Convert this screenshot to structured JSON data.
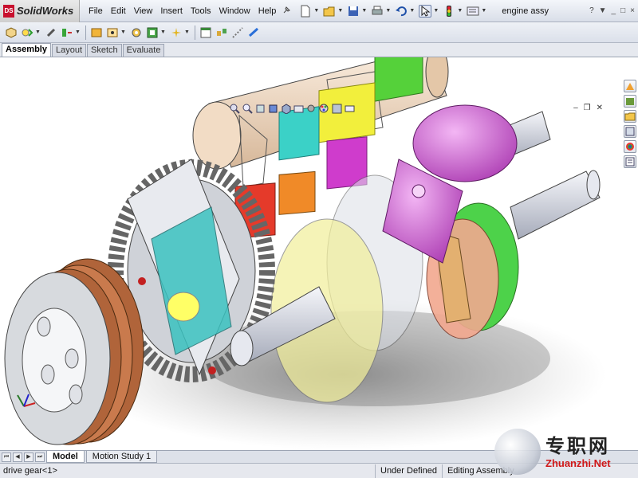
{
  "app": {
    "brand": "SolidWorks",
    "menus": [
      "File",
      "Edit",
      "View",
      "Insert",
      "Tools",
      "Window",
      "Help"
    ],
    "document_title": "engine assy",
    "window_controls": [
      "?",
      "_",
      "□",
      "×"
    ]
  },
  "toolbar_icons": [
    "new-icon",
    "open-icon",
    "save-icon",
    "print-icon",
    "undo-icon",
    "select-icon",
    "rebuild-icon",
    "options-icon"
  ],
  "command_icons": [
    "insert-component-icon",
    "mate-icon",
    "smart-fasteners-icon",
    "linear-pattern-icon",
    "move-component-icon",
    "show-hidden-icon",
    "assembly-features-icon",
    "reference-geometry-icon",
    "new-motion-study-icon",
    "bill-of-materials-icon",
    "exploded-view-icon",
    "explode-line-sketch-icon",
    "interference-detection-icon",
    "instant3d-icon"
  ],
  "command_tabs": [
    {
      "label": "Assembly",
      "active": true
    },
    {
      "label": "Layout",
      "active": false
    },
    {
      "label": "Sketch",
      "active": false
    },
    {
      "label": "Evaluate",
      "active": false
    }
  ],
  "view_tools": [
    "zoom-to-fit-icon",
    "zoom-to-area-icon",
    "previous-view-icon",
    "section-view-icon",
    "view-orientation-icon",
    "display-style-icon",
    "hide-show-items-icon",
    "edit-appearance-icon",
    "apply-scene-icon",
    "view-settings-icon"
  ],
  "task_pane": [
    "solidworks-resources-icon",
    "design-library-icon",
    "file-explorer-icon",
    "view-palette-icon",
    "appearances-icon",
    "custom-properties-icon"
  ],
  "bottom_tabs": [
    {
      "label": "Model",
      "active": true
    },
    {
      "label": "Motion Study 1",
      "active": false
    }
  ],
  "status": {
    "selection": "drive gear<1>",
    "definition": "Under Defined",
    "mode": "Editing Assembly"
  },
  "watermark": {
    "chinese": "专职网",
    "url": "Zhuanzhi.Net"
  },
  "colors": {
    "accent_red": "#c8102e",
    "piston": "#d56ad8",
    "gear_green": "#55d13a",
    "gear_yellow": "#f2ef3c",
    "gear_red": "#e53a2a",
    "gear_cyan": "#3bd1c7",
    "clutch_plates": "#b0643a",
    "shaft_tan": "#f1dcc6"
  }
}
